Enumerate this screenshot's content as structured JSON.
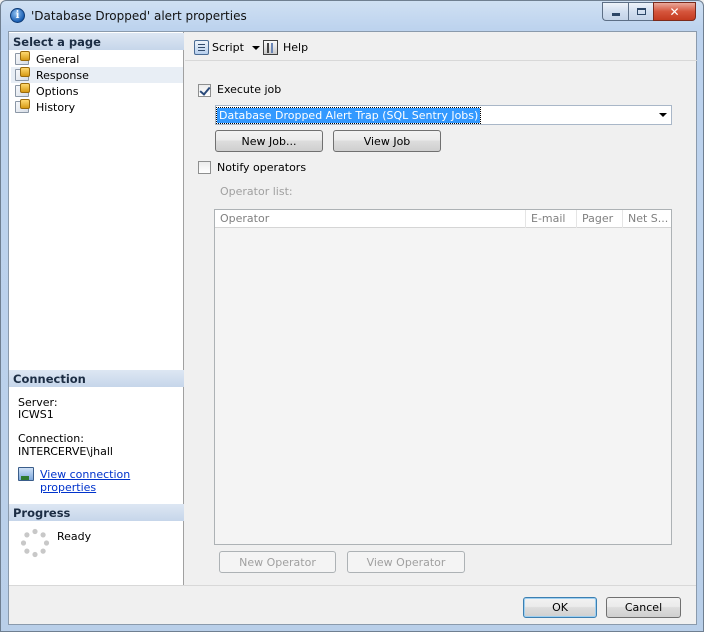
{
  "window": {
    "title": "'Database Dropped' alert properties",
    "title_icon": "info-icon"
  },
  "sidebar": {
    "select_header": "Select a page",
    "pages": [
      {
        "label": "General",
        "icon": "page-icon"
      },
      {
        "label": "Response",
        "icon": "page-icon",
        "selected": true
      },
      {
        "label": "Options",
        "icon": "page-icon"
      },
      {
        "label": "History",
        "icon": "page-icon"
      }
    ],
    "connection_header": "Connection",
    "server_label": "Server:",
    "server_value": "ICWS1",
    "connection_label": "Connection:",
    "connection_value": "INTERCERVE\\jhall",
    "view_connection_link": "View connection properties",
    "progress_header": "Progress",
    "progress_status": "Ready"
  },
  "toolbar": {
    "script_label": "Script",
    "help_label": "Help"
  },
  "response": {
    "execute_job_label": "Execute job",
    "execute_job_checked": true,
    "job_selected": "Database Dropped Alert Trap (SQL Sentry Jobs)",
    "new_job_label": "New Job...",
    "view_job_label": "View Job",
    "notify_operators_label": "Notify operators",
    "notify_operators_checked": false,
    "operator_list_label": "Operator list:",
    "columns": [
      "Operator",
      "E-mail",
      "Pager",
      "Net S..."
    ],
    "new_operator_label": "New Operator",
    "view_operator_label": "View Operator"
  },
  "footer": {
    "ok_label": "OK",
    "cancel_label": "Cancel"
  },
  "colors": {
    "selection": "#3399ff",
    "link": "#0033cc",
    "section_header": "#c6d6ea"
  }
}
